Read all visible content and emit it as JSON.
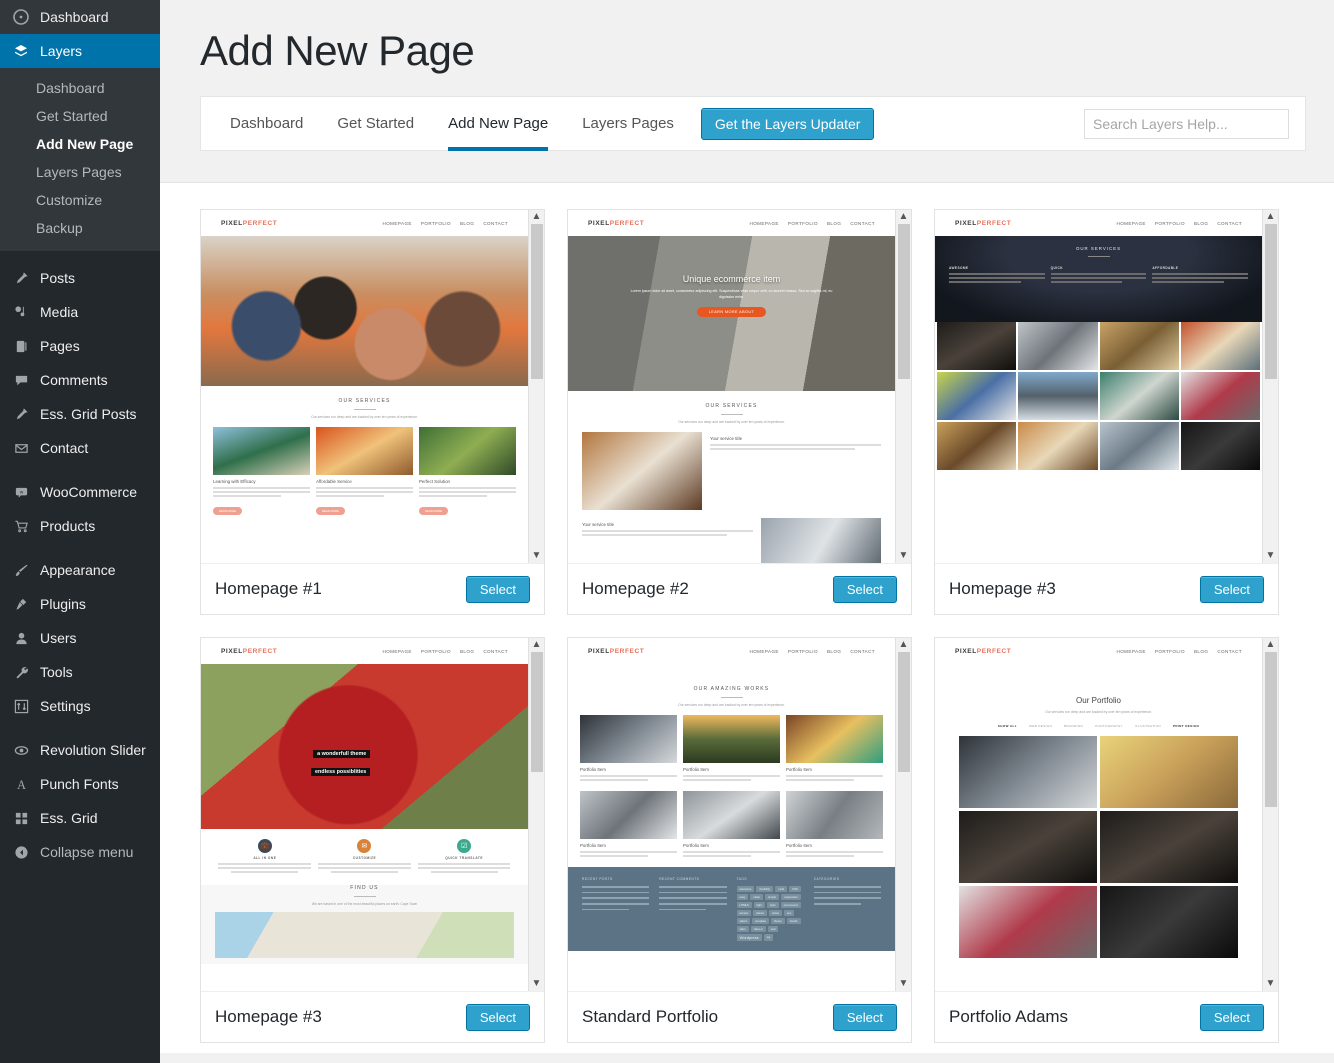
{
  "sidebar": {
    "top": {
      "label": "Dashboard",
      "icon": "dashboard-icon"
    },
    "current": {
      "label": "Layers",
      "icon": "layers-icon"
    },
    "submenu": [
      {
        "label": "Dashboard",
        "active": false
      },
      {
        "label": "Get Started",
        "active": false
      },
      {
        "label": "Add New Page",
        "active": true
      },
      {
        "label": "Layers Pages",
        "active": false
      },
      {
        "label": "Customize",
        "active": false
      },
      {
        "label": "Backup",
        "active": false
      }
    ],
    "group1": [
      {
        "label": "Posts",
        "icon": "pin-icon"
      },
      {
        "label": "Media",
        "icon": "media-icon"
      },
      {
        "label": "Pages",
        "icon": "pages-icon"
      },
      {
        "label": "Comments",
        "icon": "comment-icon"
      },
      {
        "label": "Ess. Grid Posts",
        "icon": "pin-icon"
      },
      {
        "label": "Contact",
        "icon": "envelope-icon"
      }
    ],
    "group2": [
      {
        "label": "WooCommerce",
        "icon": "woo-icon"
      },
      {
        "label": "Products",
        "icon": "cart-icon"
      }
    ],
    "group3": [
      {
        "label": "Appearance",
        "icon": "brush-icon"
      },
      {
        "label": "Plugins",
        "icon": "plug-icon"
      },
      {
        "label": "Users",
        "icon": "user-icon"
      },
      {
        "label": "Tools",
        "icon": "wrench-icon"
      },
      {
        "label": "Settings",
        "icon": "sliders-icon"
      }
    ],
    "group4": [
      {
        "label": "Revolution Slider",
        "icon": "revolution-icon"
      },
      {
        "label": "Punch Fonts",
        "icon": "font-icon"
      },
      {
        "label": "Ess. Grid",
        "icon": "grid-icon"
      }
    ],
    "collapse": {
      "label": "Collapse menu",
      "icon": "collapse-icon"
    }
  },
  "header": {
    "title": "Add New Page"
  },
  "tabbar": {
    "tabs": [
      {
        "label": "Dashboard",
        "active": false
      },
      {
        "label": "Get Started",
        "active": false
      },
      {
        "label": "Add New Page",
        "active": true
      },
      {
        "label": "Layers Pages",
        "active": false
      }
    ],
    "updater_button": "Get the Layers Updater",
    "search_placeholder": "Search Layers Help...",
    "search_value": ""
  },
  "colors": {
    "sidebar_bg": "#23282d",
    "submenu_bg": "#32373c",
    "accent_blue": "#0073aa",
    "button_blue": "#2ea2cc",
    "button_border": "#0074a2",
    "page_bg": "#f1f1f1",
    "logo_accent": "#e8705a",
    "footer_widget_bg": "#5b7384",
    "hero_button_orange": "#e8571f"
  },
  "mini_site": {
    "logo_a": "PIXEL",
    "logo_b": "PERFECT",
    "nav": [
      "HOMEPAGE",
      "PORTFOLIO",
      "BLOG",
      "CONTACT"
    ]
  },
  "cards": [
    {
      "name": "Homepage #1",
      "select_label": "Select",
      "section_title": "OUR SERVICES",
      "section_sub": "Our services run deep and are backed by over ten years of experience.",
      "services": [
        {
          "title": "Learning with Efficacy",
          "body": "Give us a brief description of the service that you are promoting. Try keep it short so that it is easy for people to scan your page.",
          "button": "READ MORE"
        },
        {
          "title": "Affordable Service",
          "body": "Give us a brief description of the service that you are promoting. Try keep it short so that it is easy for people to scan your page.",
          "button": "READ MORE"
        },
        {
          "title": "Perfect Solution",
          "body": "Give us a brief description of the service that you are promoting. Try keep it short so that it is easy for people to scan your page.",
          "button": "READ MORE"
        }
      ]
    },
    {
      "name": "Homepage #2",
      "select_label": "Select",
      "hero_title": "Unique ecommerce item",
      "hero_sub": "Lorem ipsum dolor sit amet, consectetur adipiscing elit. Suspendisse vitae neque velit, eu laoreet massa. Sed ac sagittis mi, eu dignissim enim.",
      "hero_button": "LEARN MORE ABOUT",
      "section_title": "OUR SERVICES",
      "section_sub": "Our services run deep and are backed by over ten years of experience.",
      "services": [
        {
          "title": "Your service title",
          "body": "Give us a brief description of the service that you are promoting. Try keep it short so that it is easy for people to scan your page."
        },
        {
          "title": "Your service title",
          "body": "Give us a brief description of the service that you are promoting. Try keep it short so that it is easy for people to scan your page."
        }
      ]
    },
    {
      "name": "Homepage #3",
      "select_label": "Select",
      "section_title": "OUR SERVICES",
      "services": [
        {
          "title": "AWESOME",
          "body": "Give us a brief description of the service that you are promoting. Try keep it short so that it is easy for people to scan your page."
        },
        {
          "title": "QUICK",
          "body": "Give us a brief description of the service that you are promoting. Try keep it short so that it is easy for people to scan your page."
        },
        {
          "title": "AFFORDABLE",
          "body": "Give us a brief description of the service that you are promoting. Try keep it short so that it is easy for people to scan your page."
        }
      ]
    },
    {
      "name": "Homepage #3",
      "select_label": "Select",
      "hero_line1": "a wonderfull theme",
      "hero_line2": "endless possiblities",
      "features": [
        {
          "title": "ALL IN ONE",
          "body": "Give us a brief description of the service that you are promoting. Try keep it short so that it is easy for people to scan your page."
        },
        {
          "title": "CUSTOMIZE",
          "body": "Give us a brief description of the service that you are promoting. Try keep it short so that it is easy for people to scan your page."
        },
        {
          "title": "QUICK TRANSLATE",
          "body": "Give us a brief description of the service that you are promoting. Try keep it short so that it is easy for people to scan your page."
        }
      ],
      "map_section_title": "FIND US",
      "map_section_sub": "We are based in one of the most beautiful places on earth: Cape Town"
    },
    {
      "name": "Standard Portfolio",
      "select_label": "Select",
      "section_title": "OUR AMAZING WORKS",
      "section_sub": "Our services run deep and are backed by over ten years of experience.",
      "items": [
        {
          "title": "Portfolio Item",
          "body": "Give us a brief description of the work that you are showcasing."
        },
        {
          "title": "Portfolio Item",
          "body": "Give us a brief description of the work that you are showcasing."
        },
        {
          "title": "Portfolio Item",
          "body": "Give us a brief description of the work that you are showcasing."
        },
        {
          "title": "Portfolio Item",
          "body": "Give us a brief description of the work that you are showcasing."
        },
        {
          "title": "Portfolio Item",
          "body": "Give us a brief description of the work that you are showcasing."
        },
        {
          "title": "Portfolio Item",
          "body": "Give us a brief description of the work that you are showcasing."
        }
      ],
      "footer_widgets": [
        {
          "heading": "RECENT POSTS"
        },
        {
          "heading": "RECENT COMMENTS"
        },
        {
          "heading": "TAGS"
        },
        {
          "heading": "CATEGORIES"
        }
      ],
      "tags": [
        "awesome",
        "flexibility",
        "multi",
        "CSS",
        "easy",
        "clean",
        "simple",
        "responsive",
        "HTML5",
        "light",
        "style",
        "ecommerce",
        "access",
        "planet",
        "retina",
        "seo",
        "saturn",
        "template",
        "theme",
        "trends",
        "stars",
        "video-2",
        "real",
        "Wordpress",
        "wp"
      ]
    },
    {
      "name": "Portfolio Adams",
      "select_label": "Select",
      "section_title": "Our Portfolio",
      "section_sub": "Our services run deep and are backed by over ten years of experience.",
      "filters": [
        "SHOW ALL",
        "WEB DESIGN",
        "BRANDING",
        "PHOTOGRAPHY",
        "ILLUSTRATION",
        "PRINT DESIGN"
      ]
    }
  ]
}
